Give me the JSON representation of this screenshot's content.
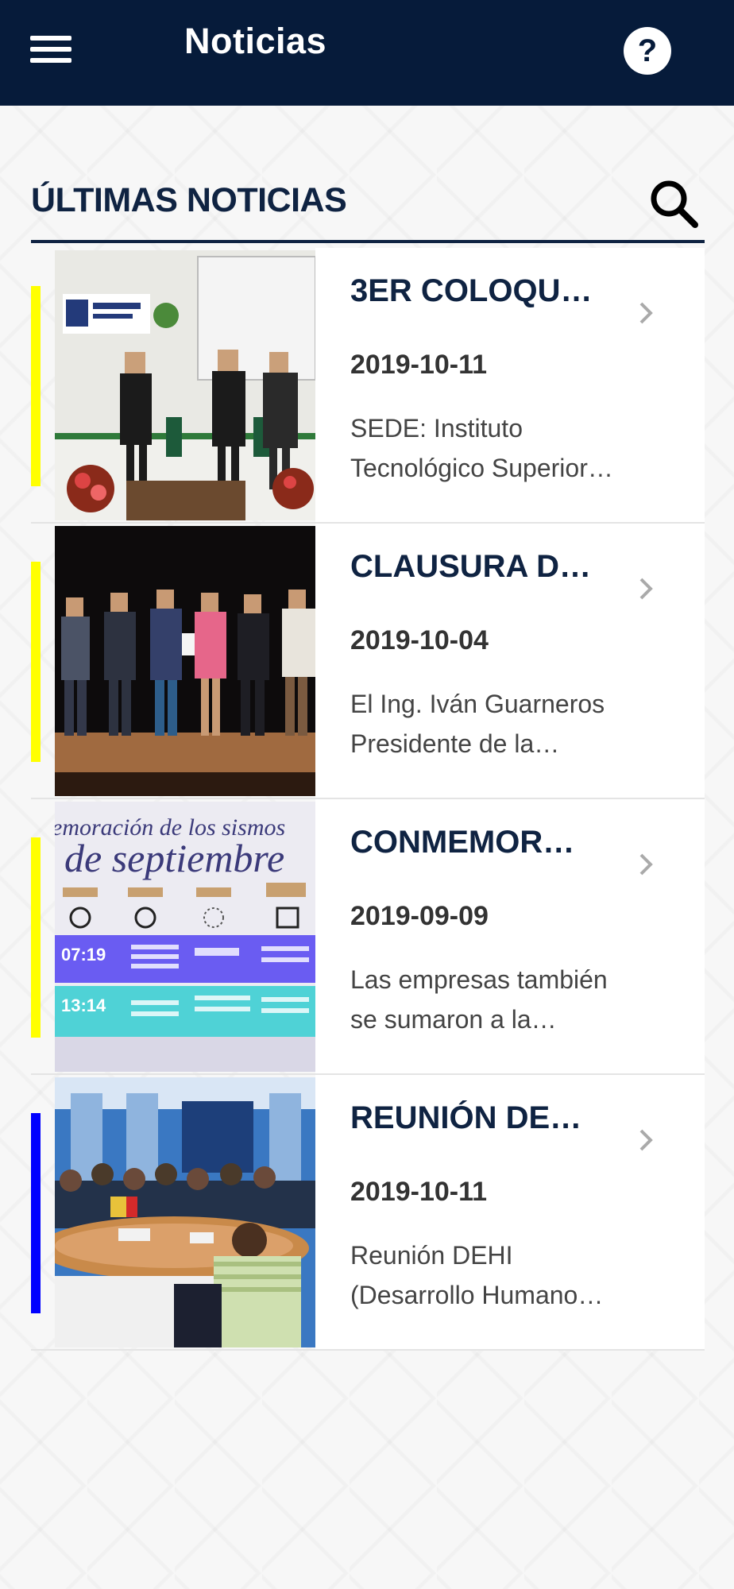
{
  "header": {
    "title": "Noticias",
    "help_glyph": "?"
  },
  "section": {
    "title": "ÚLTIMAS NOTICIAS"
  },
  "news": [
    {
      "title": "3ER COLOQUI…",
      "date": "2019-10-11",
      "desc_line1": "SEDE: Instituto",
      "desc_line2": "Tecnológico Superior…",
      "accent": "#ffff00"
    },
    {
      "title": "CLAUSURA D…",
      "date": "2019-10-04",
      "desc_line1": "El Ing. Iván Guarneros",
      "desc_line2": "Presidente de la…",
      "accent": "#ffff00"
    },
    {
      "title": "CONMEMOR…",
      "date": "2019-09-09",
      "desc_line1": "Las empresas también",
      "desc_line2": "se sumaron a la…",
      "accent": "#ffff00",
      "poster": {
        "headline_line1": "emoración de los sismos",
        "headline_line2": "de septiembre",
        "time1": "07:19",
        "time2": "13:14"
      }
    },
    {
      "title": "REUNIÓN DE…",
      "date": "2019-10-11",
      "desc_line1": "Reunión DEHI",
      "desc_line2": "(Desarrollo Humano…",
      "accent": "#0000ff"
    }
  ],
  "icons": {
    "menu": "menu-icon",
    "help": "help-icon",
    "search": "search-icon",
    "chevron": "chevron-right-icon"
  },
  "colors": {
    "header_bg": "#061b3a",
    "title_text": "#0f2342",
    "accent_yellow": "#ffff00",
    "accent_blue": "#0000ff"
  }
}
